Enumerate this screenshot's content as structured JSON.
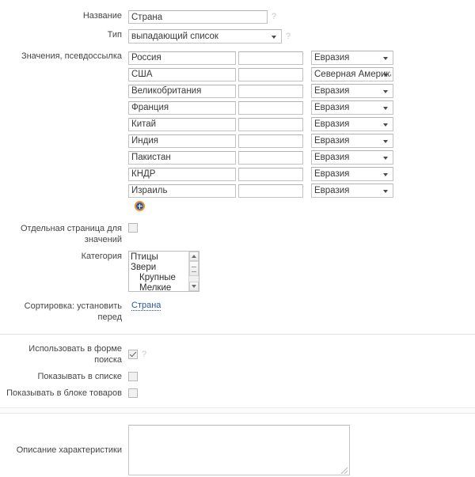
{
  "form": {
    "name_label": "Название",
    "name_value": "Страна",
    "name_hint": "?",
    "type_label": "Тип",
    "type_value": "выпадающий список",
    "type_hint": "?",
    "type_options": [
      "выпадающий список"
    ],
    "values_label": "Значения, псевдоссылка",
    "add_icon": "add-circle-icon",
    "rows": [
      {
        "value": "Россия",
        "alias": "",
        "group": "Евразия"
      },
      {
        "value": "США",
        "alias": "",
        "group": "Северная Америка"
      },
      {
        "value": "Великобритания",
        "alias": "",
        "group": "Евразия"
      },
      {
        "value": "Франция",
        "alias": "",
        "group": "Евразия"
      },
      {
        "value": "Китай",
        "alias": "",
        "group": "Евразия"
      },
      {
        "value": "Индия",
        "alias": "",
        "group": "Евразия"
      },
      {
        "value": "Пакистан",
        "alias": "",
        "group": "Евразия"
      },
      {
        "value": "КНДР",
        "alias": "",
        "group": "Евразия"
      },
      {
        "value": "Израиль",
        "alias": "",
        "group": "Евразия"
      }
    ],
    "group_options": [
      "Евразия",
      "Северная Америка"
    ],
    "separate_page_label": "Отдельная страница для значений",
    "separate_page_checked": false,
    "category_label": "Категория",
    "category_options": [
      {
        "text": "Птицы",
        "indent": false
      },
      {
        "text": "Звери",
        "indent": false
      },
      {
        "text": "Крупные",
        "indent": true
      },
      {
        "text": "Мелкие",
        "indent": true
      }
    ],
    "sort_label": "Сортировка: установить перед",
    "sort_link": "Страна",
    "flags": [
      {
        "label": "Использовать в форме поиска",
        "checked": true,
        "hint": "?"
      },
      {
        "label": "Показывать в списке",
        "checked": false,
        "hint": ""
      },
      {
        "label": "Показывать в блоке товаров",
        "checked": false,
        "hint": ""
      }
    ],
    "description_label": "Описание характеристики",
    "description_value": "",
    "description_placeholder": ""
  },
  "colors": {
    "link": "#2b56a4",
    "add_icon_ring": "#e8922a",
    "add_icon_fill": "#2b58a8",
    "border": "#c3c3c3",
    "text": "#464646"
  }
}
